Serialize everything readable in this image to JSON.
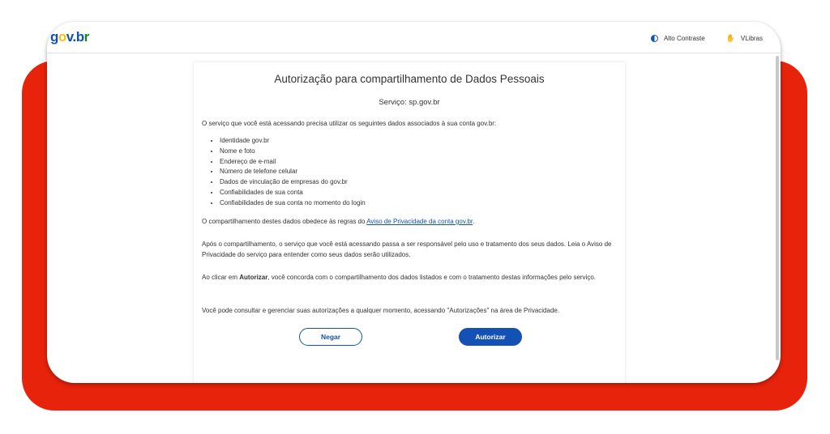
{
  "header": {
    "logo": {
      "g": "g",
      "o": "o",
      "v": "v",
      "dot": ".",
      "b": "b",
      "r": "r"
    },
    "contrast_label": "Alto Contraste",
    "libras_label": "VLibras"
  },
  "card": {
    "title": "Autorização para compartilhamento de Dados Pessoais",
    "service": "Serviço: sp.gov.br",
    "intro": "O serviço que você está acessando precisa utilizar os seguintes dados associados à sua conta gov.br:",
    "items": [
      "Identidade gov.br",
      "Nome e foto",
      "Endereço de e-mail",
      "Número de telefone celular",
      "Dados de vinculação de empresas do gov.br",
      "Confiabilidades de sua conta",
      "Confiabilidades de sua conta no momento do login"
    ],
    "privacy_prefix": "O compartilhamento destes dados obedece às regras do ",
    "privacy_link": "Aviso de Privacidade da conta gov.br",
    "privacy_suffix": ".",
    "after_sharing": "Após o compartilhamento, o serviço que você está acessando passa a ser responsável pelo uso e tratamento dos seus dados. Leia o Aviso de Privacidade do serviço para entender como seus dados serão utilizados.",
    "consent_prefix": "Ao clicar em ",
    "consent_bold": "Autorizar",
    "consent_suffix": ", você concorda com o compartilhamento dos dados listados e com o tratamento destas informações pelo serviço.",
    "manage": "Você pode consultar e gerenciar suas autorizações a qualquer momento, acessando \"Autorizações\" na área de Privacidade.",
    "deny_label": "Negar",
    "authorize_label": "Autorizar"
  },
  "colors": {
    "accent": "#1351b4",
    "frame_red": "#e8230c",
    "logo_yellow": "#f5c400",
    "logo_green": "#168821"
  },
  "icons": {
    "contrast": "contrast-icon",
    "libras": "hands-icon"
  }
}
